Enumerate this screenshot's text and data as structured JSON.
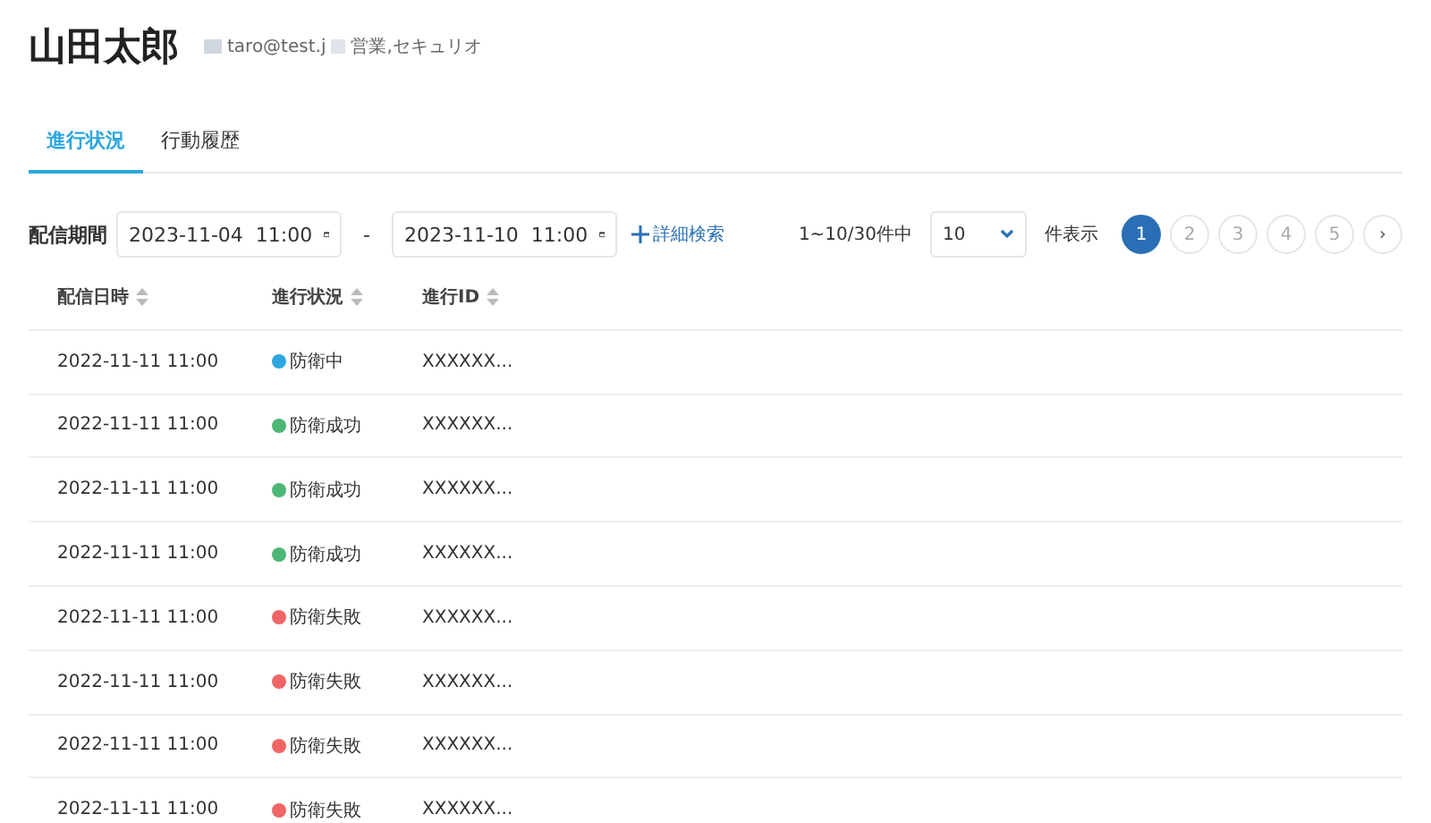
{
  "user": {
    "name": "山田太郎",
    "email": "taro@test.j",
    "tags": "営業,セキュリオ"
  },
  "tabs": [
    {
      "label": "進行状況",
      "selected": true
    },
    {
      "label": "行動履歴",
      "selected": false
    }
  ],
  "filter": {
    "label": "配信期間",
    "from": "2023-11-04  11:00",
    "separator": "-",
    "to": "2023-11-10  11:00",
    "advanced": "詳細検索"
  },
  "pager": {
    "range": "1~10/30件中",
    "per_page": "10",
    "per_page_label": "件表示",
    "pages": [
      {
        "label": "1",
        "selected": true
      },
      {
        "label": "2",
        "selected": false
      },
      {
        "label": "3",
        "selected": false
      },
      {
        "label": "4",
        "selected": false
      },
      {
        "label": "5",
        "selected": false
      }
    ],
    "next": "›"
  },
  "table": {
    "columns": [
      "配信日時",
      "進行状況",
      "進行ID"
    ],
    "rows": [
      {
        "date": "2022-11-11 11:00",
        "status": "防衛中",
        "color": "#2ea7e0",
        "id": "XXXXXX..."
      },
      {
        "date": "2022-11-11 11:00",
        "status": "防衛成功",
        "color": "#4cb774",
        "id": "XXXXXX..."
      },
      {
        "date": "2022-11-11 11:00",
        "status": "防衛成功",
        "color": "#4cb774",
        "id": "XXXXXX..."
      },
      {
        "date": "2022-11-11 11:00",
        "status": "防衛成功",
        "color": "#4cb774",
        "id": "XXXXXX..."
      },
      {
        "date": "2022-11-11 11:00",
        "status": "防衛失敗",
        "color": "#ef6565",
        "id": "XXXXXX..."
      },
      {
        "date": "2022-11-11 11:00",
        "status": "防衛失敗",
        "color": "#ef6565",
        "id": "XXXXXX..."
      },
      {
        "date": "2022-11-11 11:00",
        "status": "防衛失敗",
        "color": "#ef6565",
        "id": "XXXXXX..."
      },
      {
        "date": "2022-11-11 11:00",
        "status": "防衛失敗",
        "color": "#ef6565",
        "id": "XXXXXX..."
      }
    ]
  }
}
